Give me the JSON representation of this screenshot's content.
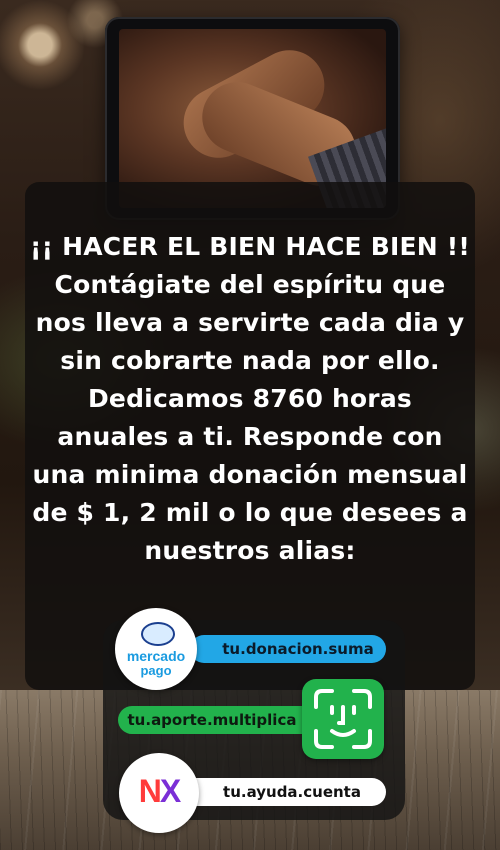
{
  "message": {
    "lines": [
      "¡¡ HACER EL BIEN HACE BIEN !!",
      "Contágiate del espíritu que",
      "nos lleva a servirte cada dia y",
      "sin cobrarte nada por ello.",
      "Dedicamos 8760 horas",
      "anuales a ti. Responde con",
      "una minima donación mensual",
      "de $ 1, 2 mil o lo que desees a",
      "nuestros alias:"
    ]
  },
  "aliases": [
    {
      "logo_text": [
        "mercado",
        "pago"
      ],
      "alias": "tu.donacion.suma",
      "color": "#22a7e6"
    },
    {
      "logo_text": [],
      "alias": "tu.aporte.multiplica",
      "color": "#22b24c"
    },
    {
      "logo_text": [
        "NX"
      ],
      "alias": "tu.ayuda.cuenta",
      "color": "#ffffff"
    }
  ],
  "icons": [
    "mercado-pago-logo-icon",
    "face-id-icon",
    "nx-logo-icon"
  ]
}
